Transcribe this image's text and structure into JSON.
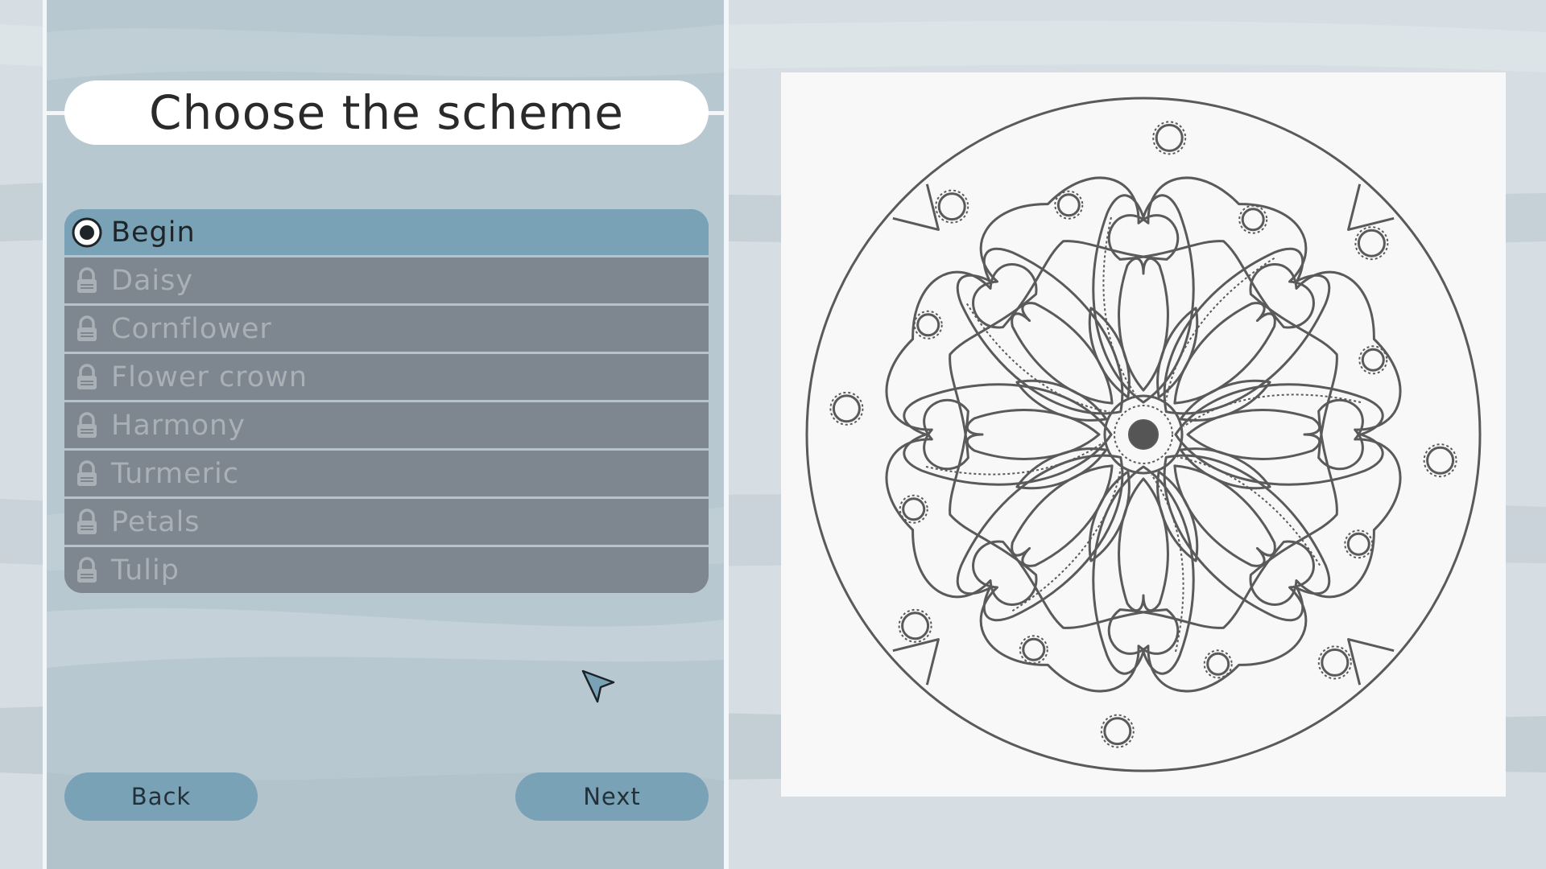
{
  "title": "Choose the scheme",
  "schemes": [
    {
      "label": "Begin",
      "state": "selected"
    },
    {
      "label": "Daisy",
      "state": "locked"
    },
    {
      "label": "Cornflower",
      "state": "locked"
    },
    {
      "label": "Flower crown",
      "state": "locked"
    },
    {
      "label": "Harmony",
      "state": "locked"
    },
    {
      "label": "Turmeric",
      "state": "locked"
    },
    {
      "label": "Petals",
      "state": "locked"
    },
    {
      "label": "Tulip",
      "state": "locked"
    }
  ],
  "buttons": {
    "back": "Back",
    "next": "Next"
  },
  "icons": {
    "selected": "radio-selected-icon",
    "locked": "lock-icon",
    "cursor": "pointer-cursor-icon"
  },
  "colors": {
    "panel": "#b7c7d0",
    "selected_row": "#7aa2b6",
    "locked_row": "#7e878f",
    "button": "#7aa2b6",
    "line_art": "#5a5a5a"
  }
}
